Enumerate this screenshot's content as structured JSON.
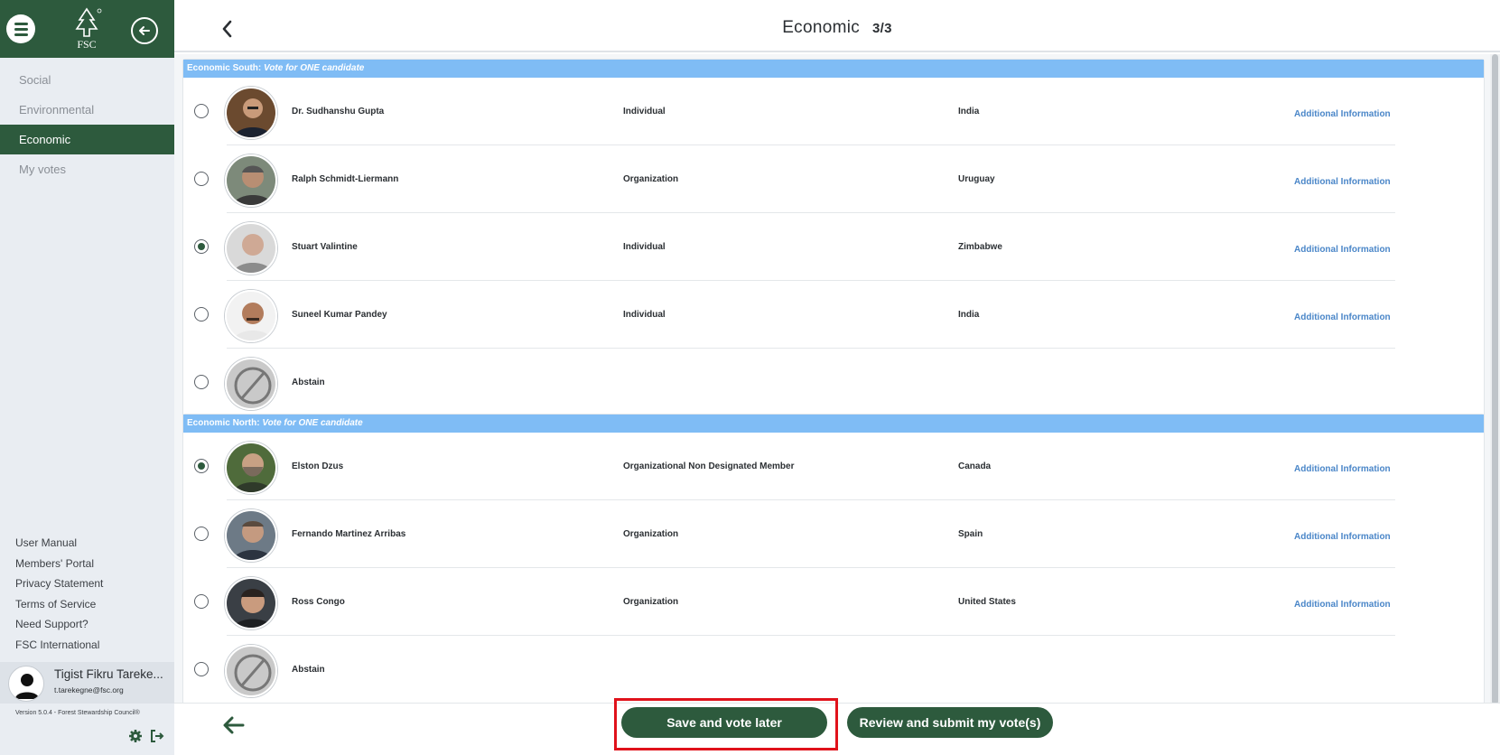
{
  "sidebar": {
    "logo_text": "FSC",
    "nav": [
      {
        "label": "Social",
        "active": false
      },
      {
        "label": "Environmental",
        "active": false
      },
      {
        "label": "Economic",
        "active": true
      },
      {
        "label": "My votes",
        "active": false
      }
    ],
    "links": [
      "User Manual",
      "Members' Portal",
      "Privacy Statement",
      "Terms of Service",
      "Need Support?",
      "FSC International"
    ],
    "user": {
      "name": "Tigist Fikru Tareke...",
      "email": "t.tarekegne@fsc.org"
    },
    "version": "Version 5.0.4 - Forest Stewardship Council®",
    "icons": [
      "menu-icon",
      "fsc-logo",
      "back-circle-icon",
      "user-avatar-icon",
      "gear-icon",
      "logout-icon"
    ]
  },
  "header": {
    "title": "Economic",
    "page": "3/3"
  },
  "sections": [
    {
      "title": "Economic South:",
      "subtitle": "Vote for ONE candidate",
      "rows": [
        {
          "name": "Dr. Sudhanshu Gupta",
          "type": "Individual",
          "country": "India",
          "info": "Additional Information",
          "selected": false
        },
        {
          "name": "Ralph Schmidt-Liermann",
          "type": "Organization",
          "country": "Uruguay",
          "info": "Additional Information",
          "selected": false
        },
        {
          "name": "Stuart Valintine",
          "type": "Individual",
          "country": "Zimbabwe",
          "info": "Additional Information",
          "selected": true
        },
        {
          "name": "Suneel Kumar Pandey",
          "type": "Individual",
          "country": "India",
          "info": "Additional Information",
          "selected": false
        },
        {
          "name": "Abstain",
          "type": "",
          "country": "",
          "info": "",
          "selected": false
        }
      ]
    },
    {
      "title": "Economic North:",
      "subtitle": "Vote for ONE candidate",
      "rows": [
        {
          "name": "Elston Dzus",
          "type": "Organizational Non Designated Member",
          "country": "Canada",
          "info": "Additional Information",
          "selected": true
        },
        {
          "name": "Fernando Martinez Arribas",
          "type": "Organization",
          "country": "Spain",
          "info": "Additional Information",
          "selected": false
        },
        {
          "name": "Ross Congo",
          "type": "Organization",
          "country": "United States",
          "info": "Additional Information",
          "selected": false
        },
        {
          "name": "Abstain",
          "type": "",
          "country": "",
          "info": "",
          "selected": false
        }
      ]
    }
  ],
  "footer": {
    "save_label": "Save and vote later",
    "review_label": "Review and submit my vote(s)"
  },
  "colors": {
    "brand": "#2d5a3d",
    "section_header": "#7fbcf5",
    "link": "#4a86c8",
    "highlight": "#e0121b"
  }
}
